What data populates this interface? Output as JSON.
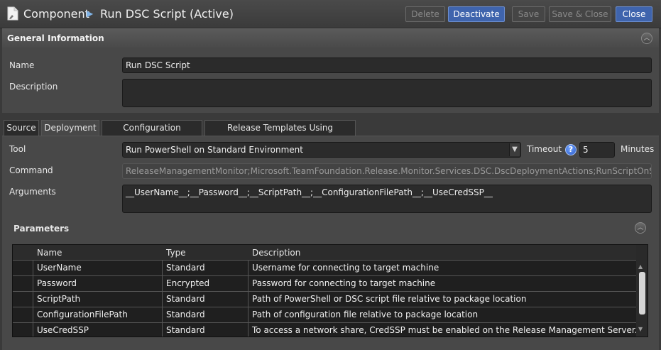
{
  "header": {
    "root": "Component",
    "arrow": "▶",
    "title": "Run DSC Script (Active)",
    "buttons": {
      "delete": "Delete",
      "deactivate": "Deactivate",
      "save": "Save",
      "save_close": "Save & Close",
      "close": "Close"
    }
  },
  "general": {
    "heading": "General Information",
    "name_label": "Name",
    "name_value": "Run DSC Script",
    "description_label": "Description",
    "description_value": ""
  },
  "tabs": [
    "Source",
    "Deployment",
    "Configuration Variables",
    "Release Templates Using Component"
  ],
  "active_tab": "Deployment",
  "deployment": {
    "tool_label": "Tool",
    "tool_value": "Run PowerShell on Standard Environment",
    "timeout_label": "Timeout",
    "timeout_value": "5",
    "timeout_unit": "Minutes",
    "command_label": "Command",
    "command_value": "ReleaseManagementMonitor;Microsoft.TeamFoundation.Release.Monitor.Services.DSC.DscDeploymentActions;RunScriptOnStandardEnvironm",
    "arguments_label": "Arguments",
    "arguments_value": "__UserName__;__Password__;__ScriptPath__;__ConfigurationFilePath__;__UseCredSSP__"
  },
  "parameters": {
    "heading": "Parameters",
    "columns": [
      "Name",
      "Type",
      "Description"
    ],
    "rows": [
      {
        "name": "UserName",
        "type": "Standard",
        "description": "Username for connecting to target machine"
      },
      {
        "name": "Password",
        "type": "Encrypted",
        "description": "Password for connecting to target machine"
      },
      {
        "name": "ScriptPath",
        "type": "Standard",
        "description": "Path of PowerShell or DSC script file relative to package location"
      },
      {
        "name": "ConfigurationFilePath",
        "type": "Standard",
        "description": "Path of configuration file relative to package location"
      },
      {
        "name": "UseCredSSP",
        "type": "Standard",
        "description": "To access a network share, CredSSP must be enabled on the Release Management Server. To enabl..."
      }
    ]
  },
  "colors": {
    "accent": "#3f64ad",
    "background": "#3a3a3a",
    "field": "#2b2b2b"
  }
}
